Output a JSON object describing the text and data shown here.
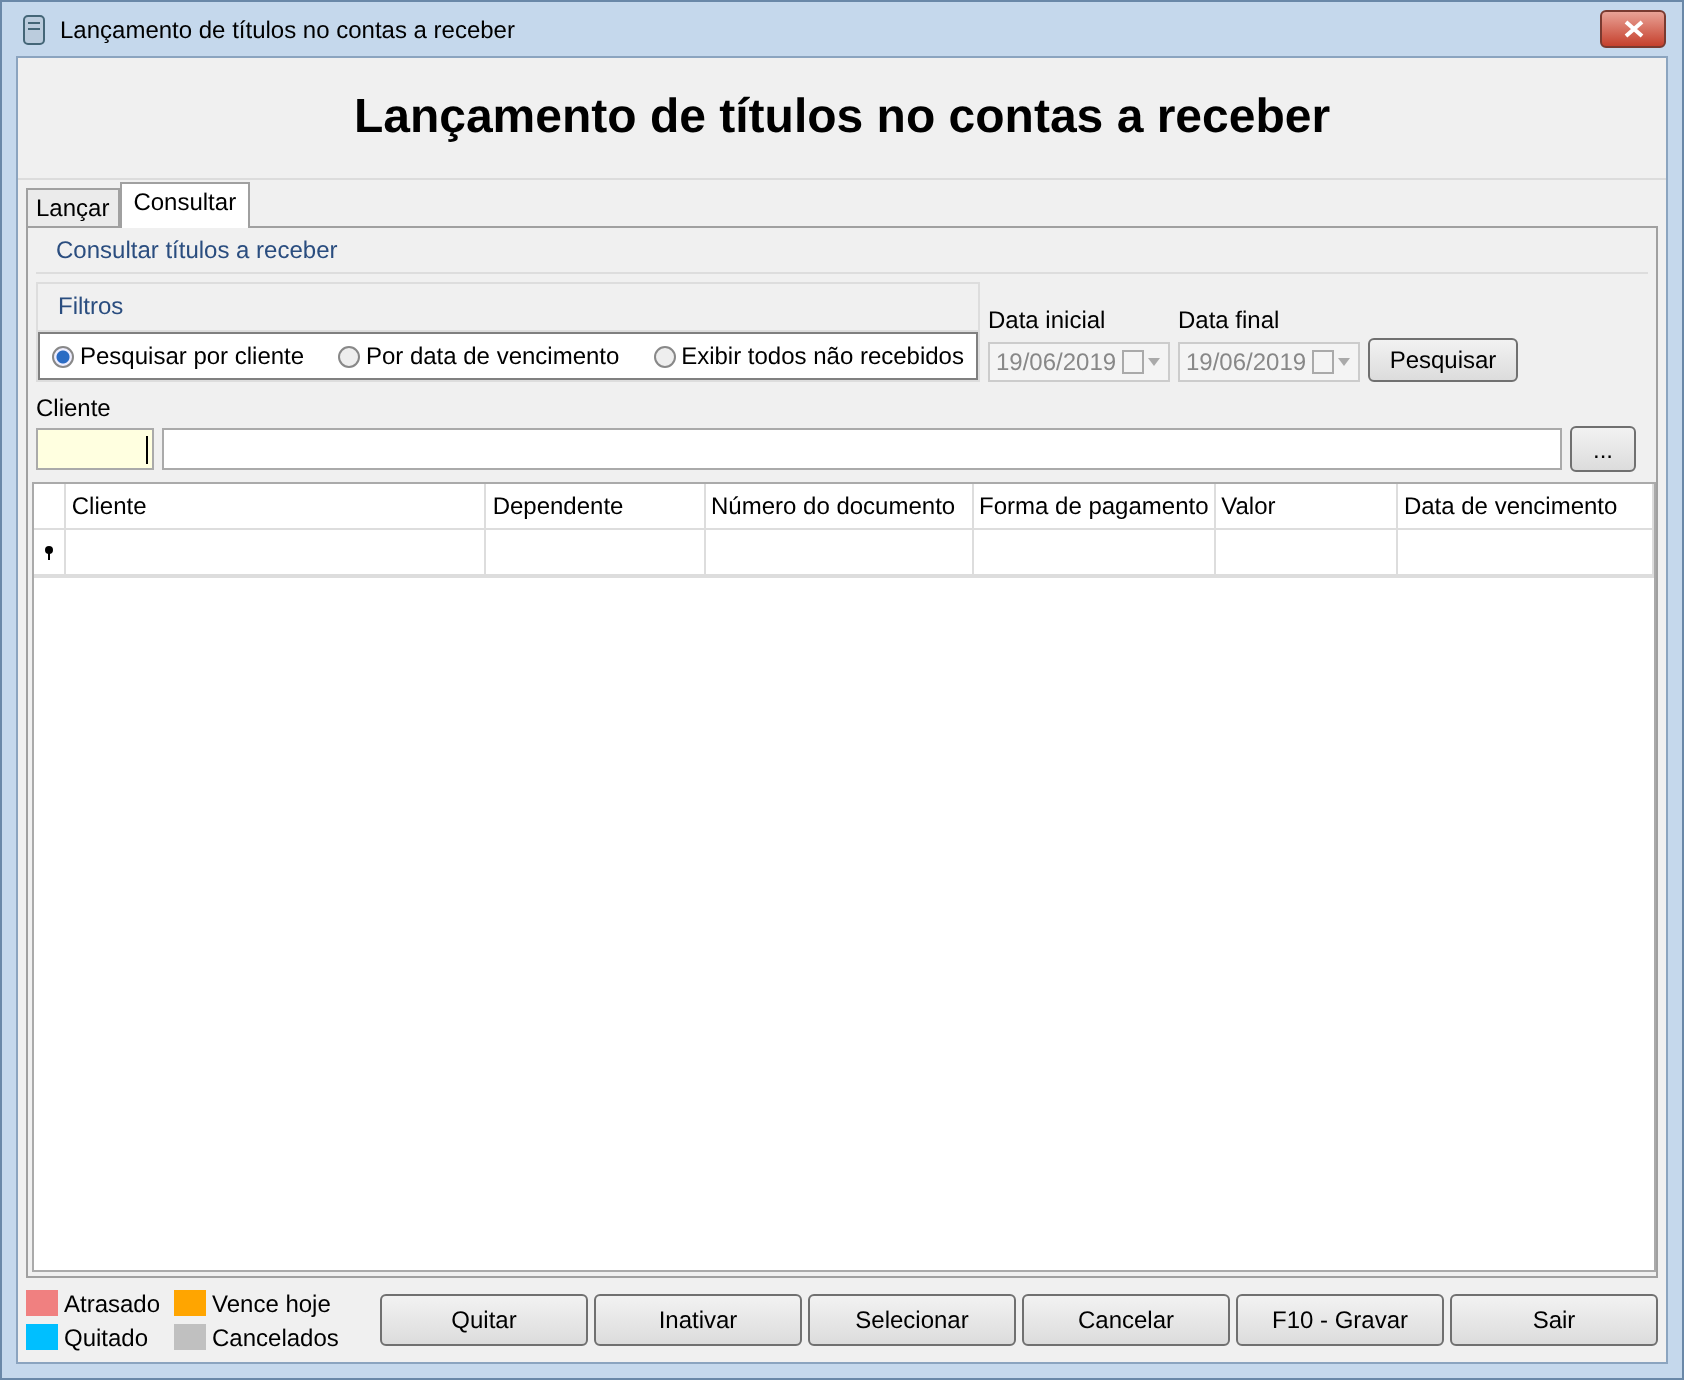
{
  "window": {
    "title": "Lançamento de títulos no contas a receber"
  },
  "header": {
    "title": "Lançamento de títulos no contas a receber"
  },
  "tabs": [
    {
      "label": "Lançar",
      "selected": false
    },
    {
      "label": "Consultar",
      "selected": true
    }
  ],
  "panel": {
    "title": "Consultar títulos a receber"
  },
  "filters": {
    "title": "Filtros",
    "options": [
      {
        "label": "Pesquisar por cliente",
        "selected": true
      },
      {
        "label": "Por data de vencimento",
        "selected": false
      },
      {
        "label": "Exibir todos não recebidos",
        "selected": false
      }
    ]
  },
  "dates": [
    {
      "label": "Data inicial",
      "value": "19/06/2019",
      "disabled": true
    },
    {
      "label": "Data final",
      "value": "19/06/2019",
      "disabled": true
    }
  ],
  "search_button": "Pesquisar",
  "client": {
    "label": "Cliente",
    "lookup_button": "..."
  },
  "table": {
    "columns": [
      "Cliente",
      "Dependente",
      "Número do documento",
      "Forma de pagamento",
      "Valor",
      "Data de vencimento"
    ]
  },
  "legend": [
    {
      "label": "Atrasado",
      "color": "#f08080"
    },
    {
      "label": "Vence hoje",
      "color": "#ffa500"
    },
    {
      "label": "Quitado",
      "color": "#00bfff"
    },
    {
      "label": "Cancelados",
      "color": "#c0c0c0"
    }
  ],
  "buttons": [
    "Quitar",
    "Inativar",
    "Selecionar",
    "Cancelar",
    "F10 - Gravar",
    "Sair"
  ]
}
